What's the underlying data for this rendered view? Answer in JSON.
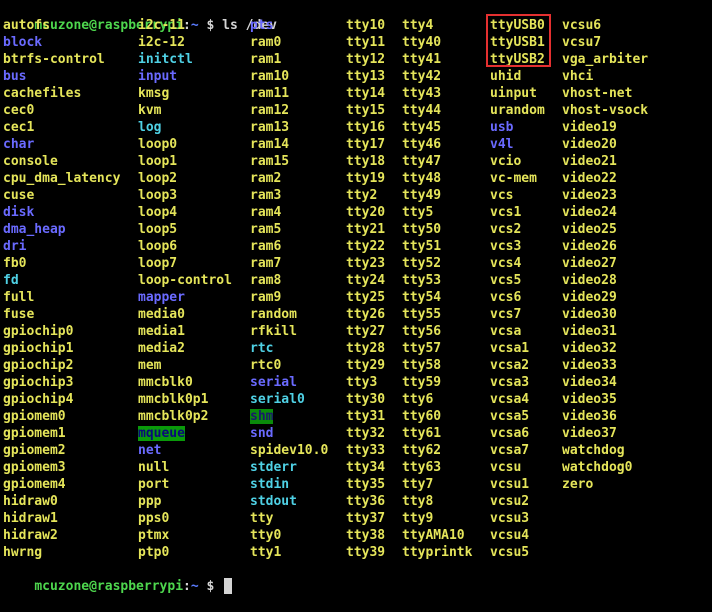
{
  "terminal": {
    "prompt_user": "mcuzone@raspberrypi",
    "prompt_colon": ":",
    "prompt_path": "~",
    "prompt_dollar": " $ ",
    "command": "ls /dev",
    "highlight_color": "#e53030"
  },
  "columns": [
    {
      "entries": [
        {
          "text": "autofs",
          "kind": "dev"
        },
        {
          "text": "block",
          "kind": "dir"
        },
        {
          "text": "btrfs-control",
          "kind": "dev"
        },
        {
          "text": "bus",
          "kind": "dir"
        },
        {
          "text": "cachefiles",
          "kind": "dev"
        },
        {
          "text": "cec0",
          "kind": "dev"
        },
        {
          "text": "cec1",
          "kind": "dev"
        },
        {
          "text": "char",
          "kind": "dir"
        },
        {
          "text": "console",
          "kind": "dev"
        },
        {
          "text": "cpu_dma_latency",
          "kind": "dev"
        },
        {
          "text": "cuse",
          "kind": "dev"
        },
        {
          "text": "disk",
          "kind": "dir"
        },
        {
          "text": "dma_heap",
          "kind": "dir"
        },
        {
          "text": "dri",
          "kind": "dir"
        },
        {
          "text": "fb0",
          "kind": "dev"
        },
        {
          "text": "fd",
          "kind": "link"
        },
        {
          "text": "full",
          "kind": "dev"
        },
        {
          "text": "fuse",
          "kind": "dev"
        },
        {
          "text": "gpiochip0",
          "kind": "dev"
        },
        {
          "text": "gpiochip1",
          "kind": "dev"
        },
        {
          "text": "gpiochip2",
          "kind": "dev"
        },
        {
          "text": "gpiochip3",
          "kind": "dev"
        },
        {
          "text": "gpiochip4",
          "kind": "dev"
        },
        {
          "text": "gpiomem0",
          "kind": "dev"
        },
        {
          "text": "gpiomem1",
          "kind": "dev"
        },
        {
          "text": "gpiomem2",
          "kind": "dev"
        },
        {
          "text": "gpiomem3",
          "kind": "dev"
        },
        {
          "text": "gpiomem4",
          "kind": "dev"
        },
        {
          "text": "hidraw0",
          "kind": "dev"
        },
        {
          "text": "hidraw1",
          "kind": "dev"
        },
        {
          "text": "hidraw2",
          "kind": "dev"
        },
        {
          "text": "hwrng",
          "kind": "dev"
        }
      ]
    },
    {
      "entries": [
        {
          "text": "i2c-11",
          "kind": "dev"
        },
        {
          "text": "i2c-12",
          "kind": "dev"
        },
        {
          "text": "initctl",
          "kind": "link"
        },
        {
          "text": "input",
          "kind": "dir"
        },
        {
          "text": "kmsg",
          "kind": "dev"
        },
        {
          "text": "kvm",
          "kind": "dev"
        },
        {
          "text": "log",
          "kind": "link"
        },
        {
          "text": "loop0",
          "kind": "dev"
        },
        {
          "text": "loop1",
          "kind": "dev"
        },
        {
          "text": "loop2",
          "kind": "dev"
        },
        {
          "text": "loop3",
          "kind": "dev"
        },
        {
          "text": "loop4",
          "kind": "dev"
        },
        {
          "text": "loop5",
          "kind": "dev"
        },
        {
          "text": "loop6",
          "kind": "dev"
        },
        {
          "text": "loop7",
          "kind": "dev"
        },
        {
          "text": "loop-control",
          "kind": "dev"
        },
        {
          "text": "mapper",
          "kind": "dir"
        },
        {
          "text": "media0",
          "kind": "dev"
        },
        {
          "text": "media1",
          "kind": "dev"
        },
        {
          "text": "media2",
          "kind": "dev"
        },
        {
          "text": "mem",
          "kind": "dev"
        },
        {
          "text": "mmcblk0",
          "kind": "dev"
        },
        {
          "text": "mmcblk0p1",
          "kind": "dev"
        },
        {
          "text": "mmcblk0p2",
          "kind": "dev"
        },
        {
          "text": "mqueue",
          "kind": "sticky"
        },
        {
          "text": "net",
          "kind": "dir"
        },
        {
          "text": "null",
          "kind": "dev"
        },
        {
          "text": "port",
          "kind": "dev"
        },
        {
          "text": "ppp",
          "kind": "dev"
        },
        {
          "text": "pps0",
          "kind": "dev"
        },
        {
          "text": "ptmx",
          "kind": "dev"
        },
        {
          "text": "ptp0",
          "kind": "dev"
        }
      ]
    },
    {
      "entries": [
        {
          "text": "pts",
          "kind": "dir"
        },
        {
          "text": "ram0",
          "kind": "dev"
        },
        {
          "text": "ram1",
          "kind": "dev"
        },
        {
          "text": "ram10",
          "kind": "dev"
        },
        {
          "text": "ram11",
          "kind": "dev"
        },
        {
          "text": "ram12",
          "kind": "dev"
        },
        {
          "text": "ram13",
          "kind": "dev"
        },
        {
          "text": "ram14",
          "kind": "dev"
        },
        {
          "text": "ram15",
          "kind": "dev"
        },
        {
          "text": "ram2",
          "kind": "dev"
        },
        {
          "text": "ram3",
          "kind": "dev"
        },
        {
          "text": "ram4",
          "kind": "dev"
        },
        {
          "text": "ram5",
          "kind": "dev"
        },
        {
          "text": "ram6",
          "kind": "dev"
        },
        {
          "text": "ram7",
          "kind": "dev"
        },
        {
          "text": "ram8",
          "kind": "dev"
        },
        {
          "text": "ram9",
          "kind": "dev"
        },
        {
          "text": "random",
          "kind": "dev"
        },
        {
          "text": "rfkill",
          "kind": "dev"
        },
        {
          "text": "rtc",
          "kind": "link"
        },
        {
          "text": "rtc0",
          "kind": "dev"
        },
        {
          "text": "serial",
          "kind": "dir"
        },
        {
          "text": "serial0",
          "kind": "link"
        },
        {
          "text": "shm",
          "kind": "shm"
        },
        {
          "text": "snd",
          "kind": "dir"
        },
        {
          "text": "spidev10.0",
          "kind": "dev"
        },
        {
          "text": "stderr",
          "kind": "link"
        },
        {
          "text": "stdin",
          "kind": "link"
        },
        {
          "text": "stdout",
          "kind": "link"
        },
        {
          "text": "tty",
          "kind": "dev"
        },
        {
          "text": "tty0",
          "kind": "dev"
        },
        {
          "text": "tty1",
          "kind": "dev"
        }
      ]
    },
    {
      "entries": [
        {
          "text": "tty10",
          "kind": "dev"
        },
        {
          "text": "tty11",
          "kind": "dev"
        },
        {
          "text": "tty12",
          "kind": "dev"
        },
        {
          "text": "tty13",
          "kind": "dev"
        },
        {
          "text": "tty14",
          "kind": "dev"
        },
        {
          "text": "tty15",
          "kind": "dev"
        },
        {
          "text": "tty16",
          "kind": "dev"
        },
        {
          "text": "tty17",
          "kind": "dev"
        },
        {
          "text": "tty18",
          "kind": "dev"
        },
        {
          "text": "tty19",
          "kind": "dev"
        },
        {
          "text": "tty2",
          "kind": "dev"
        },
        {
          "text": "tty20",
          "kind": "dev"
        },
        {
          "text": "tty21",
          "kind": "dev"
        },
        {
          "text": "tty22",
          "kind": "dev"
        },
        {
          "text": "tty23",
          "kind": "dev"
        },
        {
          "text": "tty24",
          "kind": "dev"
        },
        {
          "text": "tty25",
          "kind": "dev"
        },
        {
          "text": "tty26",
          "kind": "dev"
        },
        {
          "text": "tty27",
          "kind": "dev"
        },
        {
          "text": "tty28",
          "kind": "dev"
        },
        {
          "text": "tty29",
          "kind": "dev"
        },
        {
          "text": "tty3",
          "kind": "dev"
        },
        {
          "text": "tty30",
          "kind": "dev"
        },
        {
          "text": "tty31",
          "kind": "dev"
        },
        {
          "text": "tty32",
          "kind": "dev"
        },
        {
          "text": "tty33",
          "kind": "dev"
        },
        {
          "text": "tty34",
          "kind": "dev"
        },
        {
          "text": "tty35",
          "kind": "dev"
        },
        {
          "text": "tty36",
          "kind": "dev"
        },
        {
          "text": "tty37",
          "kind": "dev"
        },
        {
          "text": "tty38",
          "kind": "dev"
        },
        {
          "text": "tty39",
          "kind": "dev"
        }
      ]
    },
    {
      "entries": [
        {
          "text": "tty4",
          "kind": "dev"
        },
        {
          "text": "tty40",
          "kind": "dev"
        },
        {
          "text": "tty41",
          "kind": "dev"
        },
        {
          "text": "tty42",
          "kind": "dev"
        },
        {
          "text": "tty43",
          "kind": "dev"
        },
        {
          "text": "tty44",
          "kind": "dev"
        },
        {
          "text": "tty45",
          "kind": "dev"
        },
        {
          "text": "tty46",
          "kind": "dev"
        },
        {
          "text": "tty47",
          "kind": "dev"
        },
        {
          "text": "tty48",
          "kind": "dev"
        },
        {
          "text": "tty49",
          "kind": "dev"
        },
        {
          "text": "tty5",
          "kind": "dev"
        },
        {
          "text": "tty50",
          "kind": "dev"
        },
        {
          "text": "tty51",
          "kind": "dev"
        },
        {
          "text": "tty52",
          "kind": "dev"
        },
        {
          "text": "tty53",
          "kind": "dev"
        },
        {
          "text": "tty54",
          "kind": "dev"
        },
        {
          "text": "tty55",
          "kind": "dev"
        },
        {
          "text": "tty56",
          "kind": "dev"
        },
        {
          "text": "tty57",
          "kind": "dev"
        },
        {
          "text": "tty58",
          "kind": "dev"
        },
        {
          "text": "tty59",
          "kind": "dev"
        },
        {
          "text": "tty6",
          "kind": "dev"
        },
        {
          "text": "tty60",
          "kind": "dev"
        },
        {
          "text": "tty61",
          "kind": "dev"
        },
        {
          "text": "tty62",
          "kind": "dev"
        },
        {
          "text": "tty63",
          "kind": "dev"
        },
        {
          "text": "tty7",
          "kind": "dev"
        },
        {
          "text": "tty8",
          "kind": "dev"
        },
        {
          "text": "tty9",
          "kind": "dev"
        },
        {
          "text": "ttyAMA10",
          "kind": "dev"
        },
        {
          "text": "ttyprintk",
          "kind": "dev"
        }
      ]
    },
    {
      "entries": [
        {
          "text": "ttyUSB0",
          "kind": "dev"
        },
        {
          "text": "ttyUSB1",
          "kind": "dev"
        },
        {
          "text": "ttyUSB2",
          "kind": "dev"
        },
        {
          "text": "uhid",
          "kind": "dev"
        },
        {
          "text": "uinput",
          "kind": "dev"
        },
        {
          "text": "urandom",
          "kind": "dev"
        },
        {
          "text": "usb",
          "kind": "dir"
        },
        {
          "text": "v4l",
          "kind": "dir"
        },
        {
          "text": "vcio",
          "kind": "dev"
        },
        {
          "text": "vc-mem",
          "kind": "dev"
        },
        {
          "text": "vcs",
          "kind": "dev"
        },
        {
          "text": "vcs1",
          "kind": "dev"
        },
        {
          "text": "vcs2",
          "kind": "dev"
        },
        {
          "text": "vcs3",
          "kind": "dev"
        },
        {
          "text": "vcs4",
          "kind": "dev"
        },
        {
          "text": "vcs5",
          "kind": "dev"
        },
        {
          "text": "vcs6",
          "kind": "dev"
        },
        {
          "text": "vcs7",
          "kind": "dev"
        },
        {
          "text": "vcsa",
          "kind": "dev"
        },
        {
          "text": "vcsa1",
          "kind": "dev"
        },
        {
          "text": "vcsa2",
          "kind": "dev"
        },
        {
          "text": "vcsa3",
          "kind": "dev"
        },
        {
          "text": "vcsa4",
          "kind": "dev"
        },
        {
          "text": "vcsa5",
          "kind": "dev"
        },
        {
          "text": "vcsa6",
          "kind": "dev"
        },
        {
          "text": "vcsa7",
          "kind": "dev"
        },
        {
          "text": "vcsu",
          "kind": "dev"
        },
        {
          "text": "vcsu1",
          "kind": "dev"
        },
        {
          "text": "vcsu2",
          "kind": "dev"
        },
        {
          "text": "vcsu3",
          "kind": "dev"
        },
        {
          "text": "vcsu4",
          "kind": "dev"
        },
        {
          "text": "vcsu5",
          "kind": "dev"
        }
      ]
    },
    {
      "entries": [
        {
          "text": "vcsu6",
          "kind": "dev"
        },
        {
          "text": "vcsu7",
          "kind": "dev"
        },
        {
          "text": "vga_arbiter",
          "kind": "dev"
        },
        {
          "text": "vhci",
          "kind": "dev"
        },
        {
          "text": "vhost-net",
          "kind": "dev"
        },
        {
          "text": "vhost-vsock",
          "kind": "dev"
        },
        {
          "text": "video19",
          "kind": "dev"
        },
        {
          "text": "video20",
          "kind": "dev"
        },
        {
          "text": "video21",
          "kind": "dev"
        },
        {
          "text": "video22",
          "kind": "dev"
        },
        {
          "text": "video23",
          "kind": "dev"
        },
        {
          "text": "video24",
          "kind": "dev"
        },
        {
          "text": "video25",
          "kind": "dev"
        },
        {
          "text": "video26",
          "kind": "dev"
        },
        {
          "text": "video27",
          "kind": "dev"
        },
        {
          "text": "video28",
          "kind": "dev"
        },
        {
          "text": "video29",
          "kind": "dev"
        },
        {
          "text": "video30",
          "kind": "dev"
        },
        {
          "text": "video31",
          "kind": "dev"
        },
        {
          "text": "video32",
          "kind": "dev"
        },
        {
          "text": "video33",
          "kind": "dev"
        },
        {
          "text": "video34",
          "kind": "dev"
        },
        {
          "text": "video35",
          "kind": "dev"
        },
        {
          "text": "video36",
          "kind": "dev"
        },
        {
          "text": "video37",
          "kind": "dev"
        },
        {
          "text": "watchdog",
          "kind": "dev"
        },
        {
          "text": "watchdog0",
          "kind": "dev"
        },
        {
          "text": "zero",
          "kind": "dev"
        }
      ]
    }
  ]
}
